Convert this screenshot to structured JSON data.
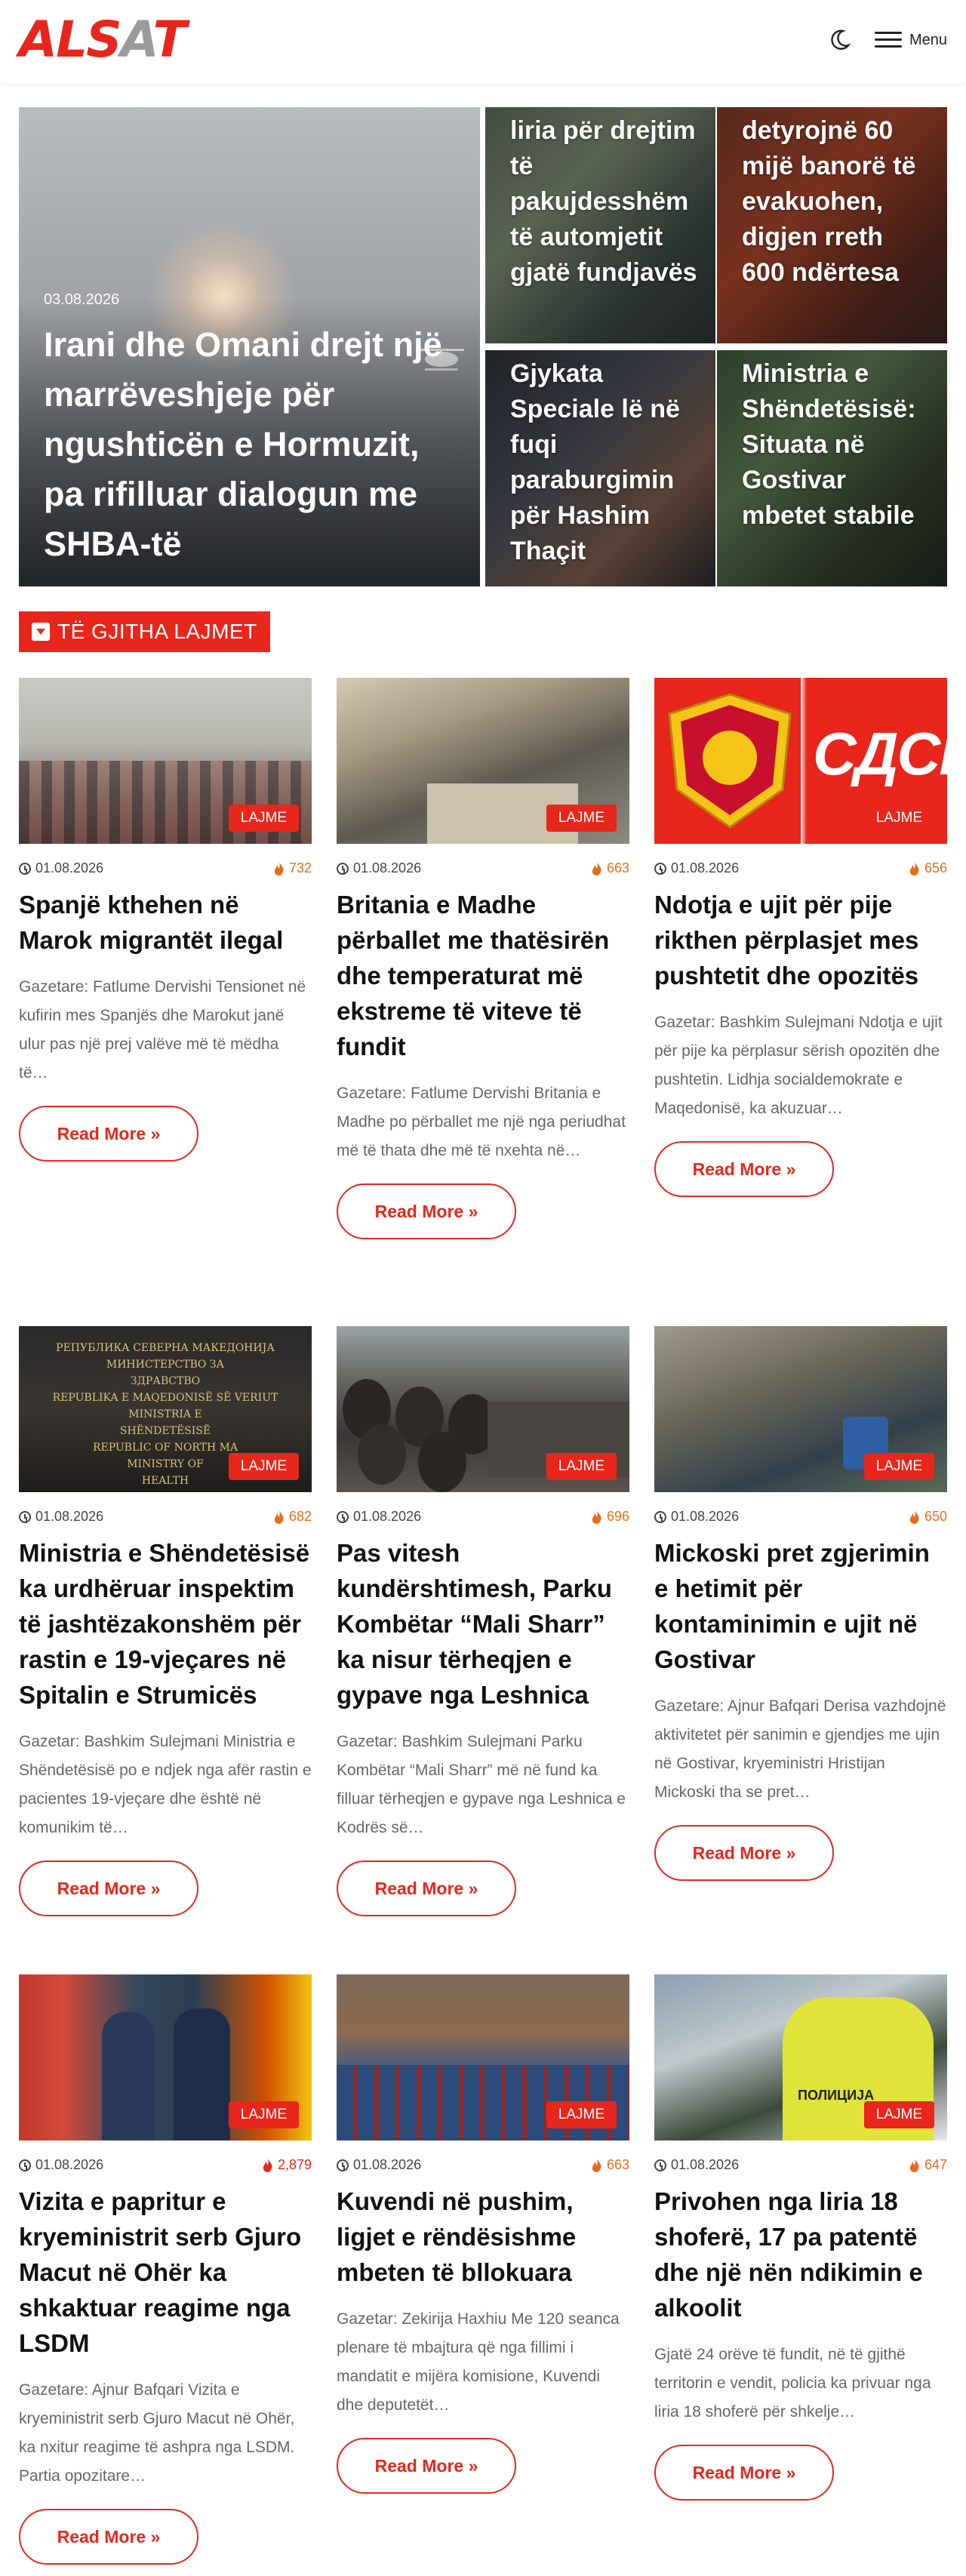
{
  "header": {
    "logo_main": "ALS",
    "logo_accent": "A",
    "logo_end": "T",
    "menu_label": "Menu"
  },
  "hero": {
    "main": {
      "date": "03.08.2026",
      "title": "Irani dhe Omani drejt një marrëveshjeje për ngushticën e Hormuzit, pa rifilluar dialogun me SHBA-të"
    },
    "small": [
      {
        "title": "liria për drejtim të pakujdesshëm të automjetit gjatë fundjavës"
      },
      {
        "title": "detyrojnë 60 mijë banorë të evakuohen, digjen rreth 600 ndërtesa"
      },
      {
        "title": "Gjykata Speciale lë në fuqi paraburgimin për Hashim Thaçit"
      },
      {
        "title": "Ministria e Shëndetësisë: Situata në Gostivar mbetet stabile"
      }
    ]
  },
  "section": {
    "label": "TË GJITHA LAJMET"
  },
  "cards": [
    {
      "category": "LAJME",
      "date": "01.08.2026",
      "views": "732",
      "title": "Spanjë kthehen në Marok migrantët ilegal",
      "excerpt": "Gazetare: Fatlume Dervishi Tensionet në kufirin mes Spanjës dhe Marokut janë ulur pas një prej valëve më të mëdha të…",
      "more": "Read More »"
    },
    {
      "category": "LAJME",
      "date": "01.08.2026",
      "views": "663",
      "title": "Britania e Madhe përballet me thatësirën dhe temperaturat më ekstreme të viteve të fundit",
      "excerpt": "Gazetare: Fatlume Dervishi Britania e Madhe po përballet me një nga periudhat më të thata dhe më të nxehta në…",
      "more": "Read More »"
    },
    {
      "category": "LAJME",
      "date": "01.08.2026",
      "views": "656",
      "title": "Ndotja e ujit për pije rikthen përplasjet mes pushtetit dhe opozitës",
      "excerpt": "Gazetar: Bashkim Sulejmani Ndotja e ujit për pije ka përplasur sërish opozitën dhe pushtetin. Lidhja socialdemokrate e Maqedonisë, ka akuzuar…",
      "more": "Read More »",
      "thumb_text": "СДСМ"
    },
    {
      "category": "LAJME",
      "date": "01.08.2026",
      "views": "682",
      "title": "Ministria e Shëndetësisë ka urdhëruar inspektim të jashtëzakonshëm për rastin e 19-vjeçares në Spitalin e Strumicës",
      "excerpt": "Gazetar: Bashkim Sulejmani Ministria e Shëndetësisë po e ndjek nga afër rastin e pacientes 19-vjeçare dhe është në komunikim të…",
      "more": "Read More »",
      "thumb_lines": [
        "РЕПУБЛИКА СЕВЕРНА МАКЕДОНИЈА",
        "МИНИСТЕРСТВО ЗА",
        "ЗДРАВСТВО",
        "REPUBLIKA E MAQEDONISË SË VERIUT",
        "MINISTRIA E",
        "SHËNDETËSISË",
        "REPUBLIC OF NORTH MA",
        "MINISTRY OF",
        "HEALTH"
      ]
    },
    {
      "category": "LAJME",
      "date": "01.08.2026",
      "views": "696",
      "title": "Pas vitesh kundërshtimesh, Parku Kombëtar “Mali Sharr” ka nisur tërheqjen e gypave nga Leshnica",
      "excerpt": "Gazetar: Bashkim Sulejmani Parku Kombëtar “Mali Sharr” më në fund ka filluar tërheqjen e gypave nga Leshnica e Kodrës së…",
      "more": "Read More »"
    },
    {
      "category": "LAJME",
      "date": "01.08.2026",
      "views": "650",
      "title": "Mickoski pret zgjerimin e hetimit për kontaminimin e ujit në Gostivar",
      "excerpt": "Gazetare: Ajnur Bafqari Derisa vazhdojnë aktivitetet për sanimin e gjendjes me ujin në Gostivar, kryeministri Hristijan Mickoski tha se pret…",
      "more": "Read More »"
    },
    {
      "category": "LAJME",
      "date": "01.08.2026",
      "views": "2,879",
      "title": "Vizita e papritur e kryeministrit serb Gjuro Macut në Ohër ka shkaktuar reagime nga LSDM",
      "excerpt": "Gazetare: Ajnur Bafqari Vizita e kryeministrit serb Gjuro Macut në Ohër, ka nxitur reagime të ashpra nga LSDM. Partia opozitare…",
      "more": "Read More »"
    },
    {
      "category": "LAJME",
      "date": "01.08.2026",
      "views": "663",
      "title": "Kuvendi në pushim, ligjet e rëndësishme mbeten të bllokuara",
      "excerpt": "Gazetar: Zekirija Haxhiu Me 120 seanca plenare të mbajtura që nga fillimi i mandatit e mijëra komisione, Kuvendi dhe deputetët…",
      "more": "Read More »"
    },
    {
      "category": "LAJME",
      "date": "01.08.2026",
      "views": "647",
      "title": "Privohen nga liria 18 shoferë, 17 pa patentë dhe një nën ndikimin e alkoolit",
      "excerpt": "Gjatë 24 orëve të fundit, në të gjithë territorin e vendit, policia ka privuar nga liria 18 shoferë për shkelje…",
      "more": "Read More »",
      "thumb_text": "ПОЛИЦИЈА"
    }
  ]
}
